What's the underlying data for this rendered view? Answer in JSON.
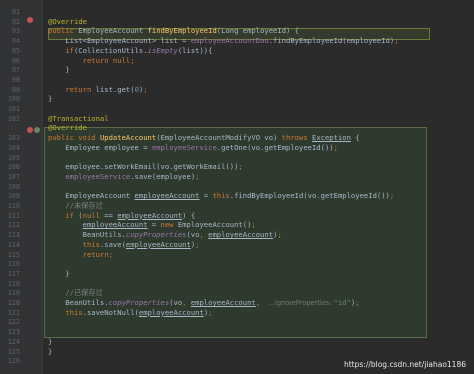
{
  "lines": [
    {
      "ln": "91",
      "html": ""
    },
    {
      "ln": "92",
      "html": "<span class='a'>@Override</span>"
    },
    {
      "ln": "93",
      "html": "<span class='k'>public </span>EmployeeAccount <span class='m'>findByEmployeeId</span>(Long employeeId) {"
    },
    {
      "ln": "94",
      "html": "    List&lt;EmployeeAccount&gt; list = <span class='f'>employeeAccountDao</span>.findByEmployeeId(employeeId)<span class='k'>;</span>"
    },
    {
      "ln": "95",
      "html": "    <span class='k'>if</span>(CollectionUtils.<span class='fi'>isEmpty</span>(list)){"
    },
    {
      "ln": "96",
      "html": "        <span class='k'>return null;</span>"
    },
    {
      "ln": "97",
      "html": "    }"
    },
    {
      "ln": "98",
      "html": ""
    },
    {
      "ln": "99",
      "html": "    <span class='k'>return </span>list.get(<span class='n'>0</span>)<span class='k'>;</span>"
    },
    {
      "ln": "100",
      "html": "}"
    },
    {
      "ln": "101",
      "html": ""
    },
    {
      "ln": "102",
      "html": "<span class='a'>@Transactional</span>"
    },
    {
      "ln": "",
      "html": "<span class='a'>@Override</span>"
    },
    {
      "ln": "103",
      "html": "<span class='k'>public void </span><span class='m'>UpdateAccount</span>(EmployeeAccountModifyVO vo) <span class='k'>throws </span><span class='u'>Exception</span> {"
    },
    {
      "ln": "104",
      "html": "    Employee employee = <span class='f'>employeeService</span>.getOne(vo.getEmployeeId())<span class='k'>;</span>"
    },
    {
      "ln": "105",
      "html": ""
    },
    {
      "ln": "106",
      "html": "    employee.setWorkEmail(vo.getWorkEmail())<span class='k'>;</span>"
    },
    {
      "ln": "107",
      "html": "    <span class='f'>employeeService</span>.save(employee)<span class='k'>;</span>"
    },
    {
      "ln": "108",
      "html": ""
    },
    {
      "ln": "109",
      "html": "    EmployeeAccount <span class='u'>employeeAccount</span> = <span class='k'>this</span>.findByEmployeeId(vo.getEmployeeId())<span class='k'>;</span>"
    },
    {
      "ln": "110",
      "html": "    <span class='c'>//未保存过</span>"
    },
    {
      "ln": "111",
      "html": "    <span class='k'>if </span>(<span class='k'>null </span>== <span class='u'>employeeAccount</span>) {"
    },
    {
      "ln": "112",
      "html": "        <span class='u'>employeeAccount</span> = <span class='k'>new </span>EmployeeAccount()<span class='k'>;</span>"
    },
    {
      "ln": "113",
      "html": "        BeanUtils.<span class='fi'>copyProperties</span>(vo<span class='k'>, </span><span class='u'>employeeAccount</span>)<span class='k'>;</span>"
    },
    {
      "ln": "114",
      "html": "        <span class='k'>this</span>.save(<span class='u'>employeeAccount</span>)<span class='k'>;</span>"
    },
    {
      "ln": "115",
      "html": "        <span class='k'>return;</span>"
    },
    {
      "ln": "116",
      "html": ""
    },
    {
      "ln": "117",
      "html": "    }"
    },
    {
      "ln": "118",
      "html": ""
    },
    {
      "ln": "119",
      "html": "    <span class='c'>//已保存过</span>"
    },
    {
      "ln": "120",
      "html": "    BeanUtils.<span class='fi'>copyProperties</span>(vo<span class='k'>, </span><span class='u'>employeeAccount</span><span class='k'>,  </span><span class='hint'>...ignoreProperties: </span><span style='color:#6a8759'>\"id\"</span>)<span class='k'>;</span>"
    },
    {
      "ln": "121",
      "html": "    <span class='k'>this</span>.saveNotNull(<span class='u'>employeeAccount</span>)<span class='k'>;</span>"
    },
    {
      "ln": "122",
      "html": ""
    },
    {
      "ln": "123",
      "html": ""
    },
    {
      "ln": "124",
      "html": "}"
    },
    {
      "ln": "125",
      "html": "}"
    },
    {
      "ln": "126",
      "html": ""
    }
  ],
  "watermark": "https://blog.csdn.net/jiahao1186"
}
